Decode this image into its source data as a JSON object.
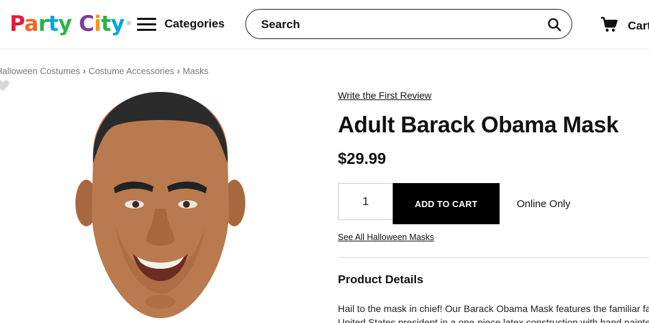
{
  "header": {
    "logo": {
      "word1": "Party",
      "word2": "City",
      "letter_colors": [
        "#e21a3b",
        "#f26522",
        "#2bb24c",
        "#00a5df",
        "#2bb24c",
        "#7a3f98",
        "#f7941d",
        "#2bb24c",
        "#00a5df"
      ],
      "tm": "®"
    },
    "categories_label": "Categories",
    "search": {
      "placeholder": "Search"
    },
    "cart_label": "Cart"
  },
  "breadcrumb": {
    "items": [
      "Halloween Costumes",
      "Costume Accessories",
      "Masks"
    ]
  },
  "product": {
    "review_link": "Write the First Review",
    "title": "Adult Barack Obama Mask",
    "price": "$29.99",
    "quantity": "1",
    "add_to_cart_label": "ADD TO CART",
    "availability": "Online Only",
    "see_all_link": "See All Halloween Masks",
    "details_heading": "Product Details",
    "description_line1": "Hail to the mask in chief! Our Barack Obama Mask features the familiar face of",
    "description_line2": "United States president in a one-piece latex construction with hand painted details"
  },
  "colors": {
    "button_bg": "#000000",
    "text": "#111111",
    "breadcrumb": "#777777"
  }
}
